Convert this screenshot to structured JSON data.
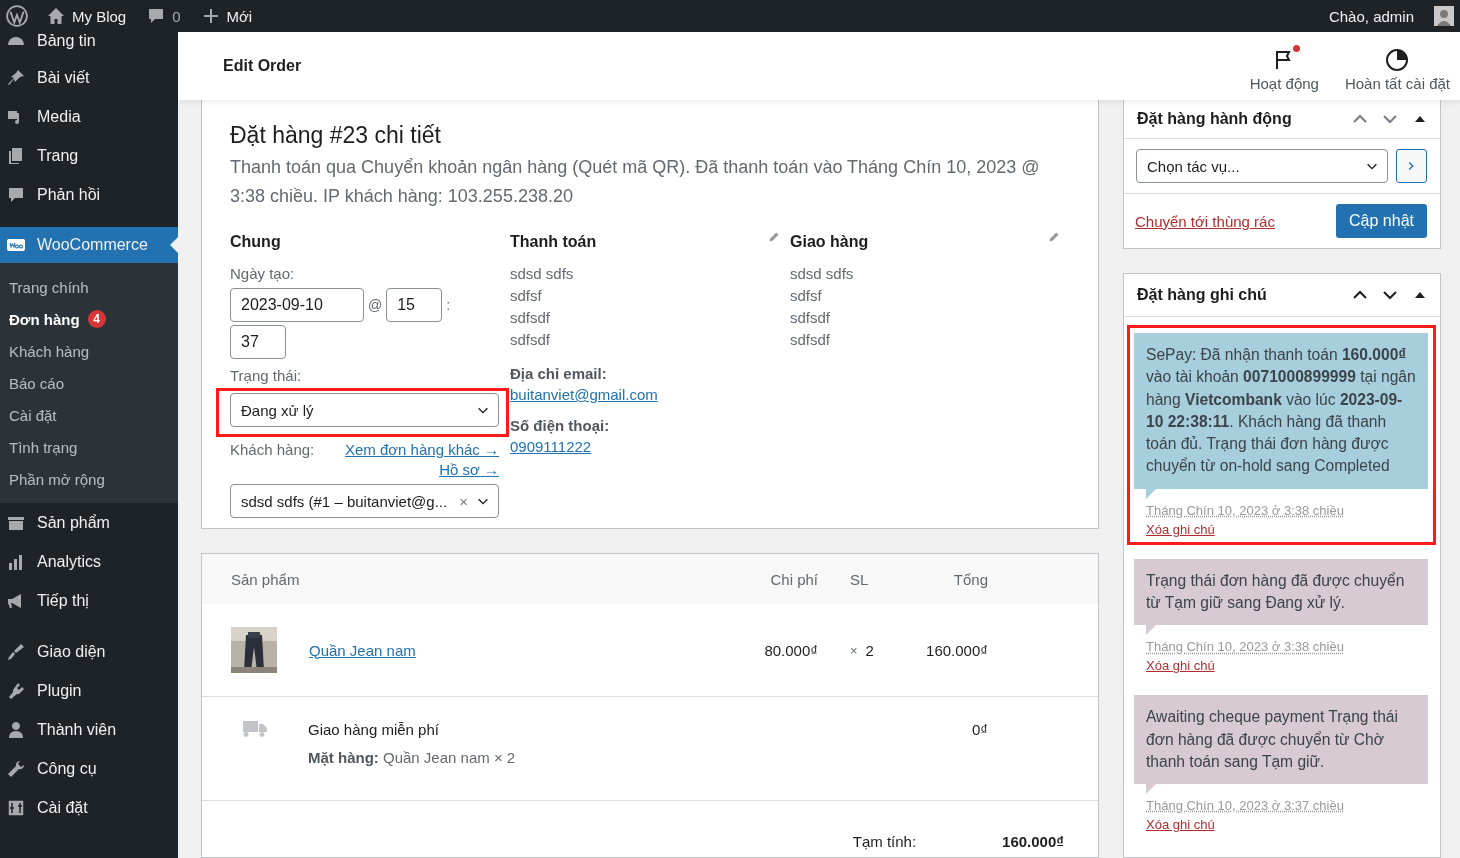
{
  "admin_bar": {
    "site": "My Blog",
    "comments": "0",
    "new": "Mới",
    "greeting": "Chào, admin"
  },
  "sidebar": {
    "groups": [
      [
        {
          "label": "Bảng tin",
          "selected": false
        },
        {
          "label": "Bài viết",
          "selected": false
        },
        {
          "label": "Media",
          "selected": false
        },
        {
          "label": "Trang",
          "selected": false
        },
        {
          "label": "Phản hồi",
          "selected": false
        },
        {
          "label": "WooCommerce",
          "selected": true,
          "children": [
            {
              "label": "Trang chính",
              "selected": false
            },
            {
              "label": "Đơn hàng",
              "selected": true,
              "badge": "4"
            },
            {
              "label": "Khách hàng",
              "selected": false
            },
            {
              "label": "Báo cáo",
              "selected": false
            },
            {
              "label": "Cài đặt",
              "selected": false
            },
            {
              "label": "Tình trạng",
              "selected": false
            },
            {
              "label": "Phần mở rộng",
              "selected": false
            }
          ]
        },
        {
          "label": "Sản phẩm",
          "selected": false
        },
        {
          "label": "Analytics",
          "selected": false
        },
        {
          "label": "Tiếp thị",
          "selected": false
        }
      ],
      [
        {
          "label": "Giao diện",
          "selected": false
        },
        {
          "label": "Plugin",
          "selected": false
        },
        {
          "label": "Thành viên",
          "selected": false
        },
        {
          "label": "Công cụ",
          "selected": false
        },
        {
          "label": "Cài đặt",
          "selected": false
        }
      ]
    ]
  },
  "header": {
    "title": "Edit Order",
    "actions": [
      {
        "label": "Hoạt động",
        "unread": true
      },
      {
        "label": "Hoàn tất cài đặt",
        "unread": false
      }
    ]
  },
  "order": {
    "title": "Đặt hàng #23 chi tiết",
    "description": "Thanh toán qua Chuyển khoản ngân hàng (Quét mã QR). Đã thanh toán vào Tháng Chín 10, 2023 @ 3:38 chiều. IP khách hàng: 103.255.238.20",
    "general": {
      "heading": "Chung",
      "date_label": "Ngày tạo:",
      "date": "2023-09-10",
      "at": "@",
      "hour": "15",
      "colon": ":",
      "minute": "37",
      "status_label": "Trạng thái:",
      "status": "Đang xử lý",
      "status_highlighted": true,
      "customer_label": "Khách hàng:",
      "other_orders_link": "Xem đơn hàng khác →",
      "profile_link": "Hồ sơ →",
      "customer": "sdsd sdfs (#1 – buitanviet@g...",
      "clear": "×"
    },
    "billing": {
      "heading": "Thanh toán",
      "address": [
        "sdsd sdfs",
        "sdfsf",
        "sdfsdf",
        "sdfsdf"
      ],
      "email_label": "Địa chỉ email:",
      "email": "buitanviet@gmail.com",
      "phone_label": "Số điện thoại:",
      "phone": "0909111222"
    },
    "shipping": {
      "heading": "Giao hàng",
      "address": [
        "sdsd sdfs",
        "sdfsf",
        "sdfsdf",
        "sdfsdf"
      ]
    }
  },
  "items": {
    "columns": [
      "Sản phẩm",
      "Chi phí",
      "SL",
      "Tổng"
    ],
    "rows": [
      {
        "kind": "product",
        "name": "Quần Jean nam",
        "cost": "80.000₫",
        "qty_sign": "×",
        "qty": "2",
        "total": "160.000₫"
      },
      {
        "kind": "shipping",
        "name": "Giao hàng miễn phí",
        "meta": "**Mặt hàng:** Quần Jean nam × 2",
        "total": "0₫"
      }
    ],
    "totals": [
      {
        "label": "Tạm tính:",
        "value": "160.000₫"
      }
    ]
  },
  "actions_box": {
    "title": "Đặt hàng hành động",
    "select": "Chọn tác vụ...",
    "trash": "Chuyển tới thùng rác",
    "update": "Cập nhật"
  },
  "notes_box": {
    "title": "Đặt hàng ghi chú",
    "notes": [
      {
        "kind": "customer",
        "highlighted": true,
        "text": "SePay: Đã nhận thanh toán **160.000₫** vào tài khoản **0071000899999** tại ngân hàng **Vietcombank** vào lúc **2023-09-10 22:38:11**. Khách hàng đã thanh toán đủ. Trạng thái đơn hàng được chuyển từ on-hold sang Completed",
        "date": "Tháng Chín 10, 2023 ở 3:38 chiều",
        "delete": "Xóa ghi chú"
      },
      {
        "kind": "system",
        "highlighted": false,
        "text": "Trạng thái đơn hàng đã được chuyển từ Tạm giữ sang Đang xử lý.",
        "date": "Tháng Chín 10, 2023 ở 3:38 chiều",
        "delete": "Xóa ghi chú"
      },
      {
        "kind": "system",
        "highlighted": false,
        "text": "Awaiting cheque payment Trạng thái đơn hàng đã được chuyển từ Chờ thanh toán sang Tạm giữ.",
        "date": "Tháng Chín 10, 2023 ở 3:37 chiều",
        "delete": "Xóa ghi chú"
      }
    ]
  }
}
